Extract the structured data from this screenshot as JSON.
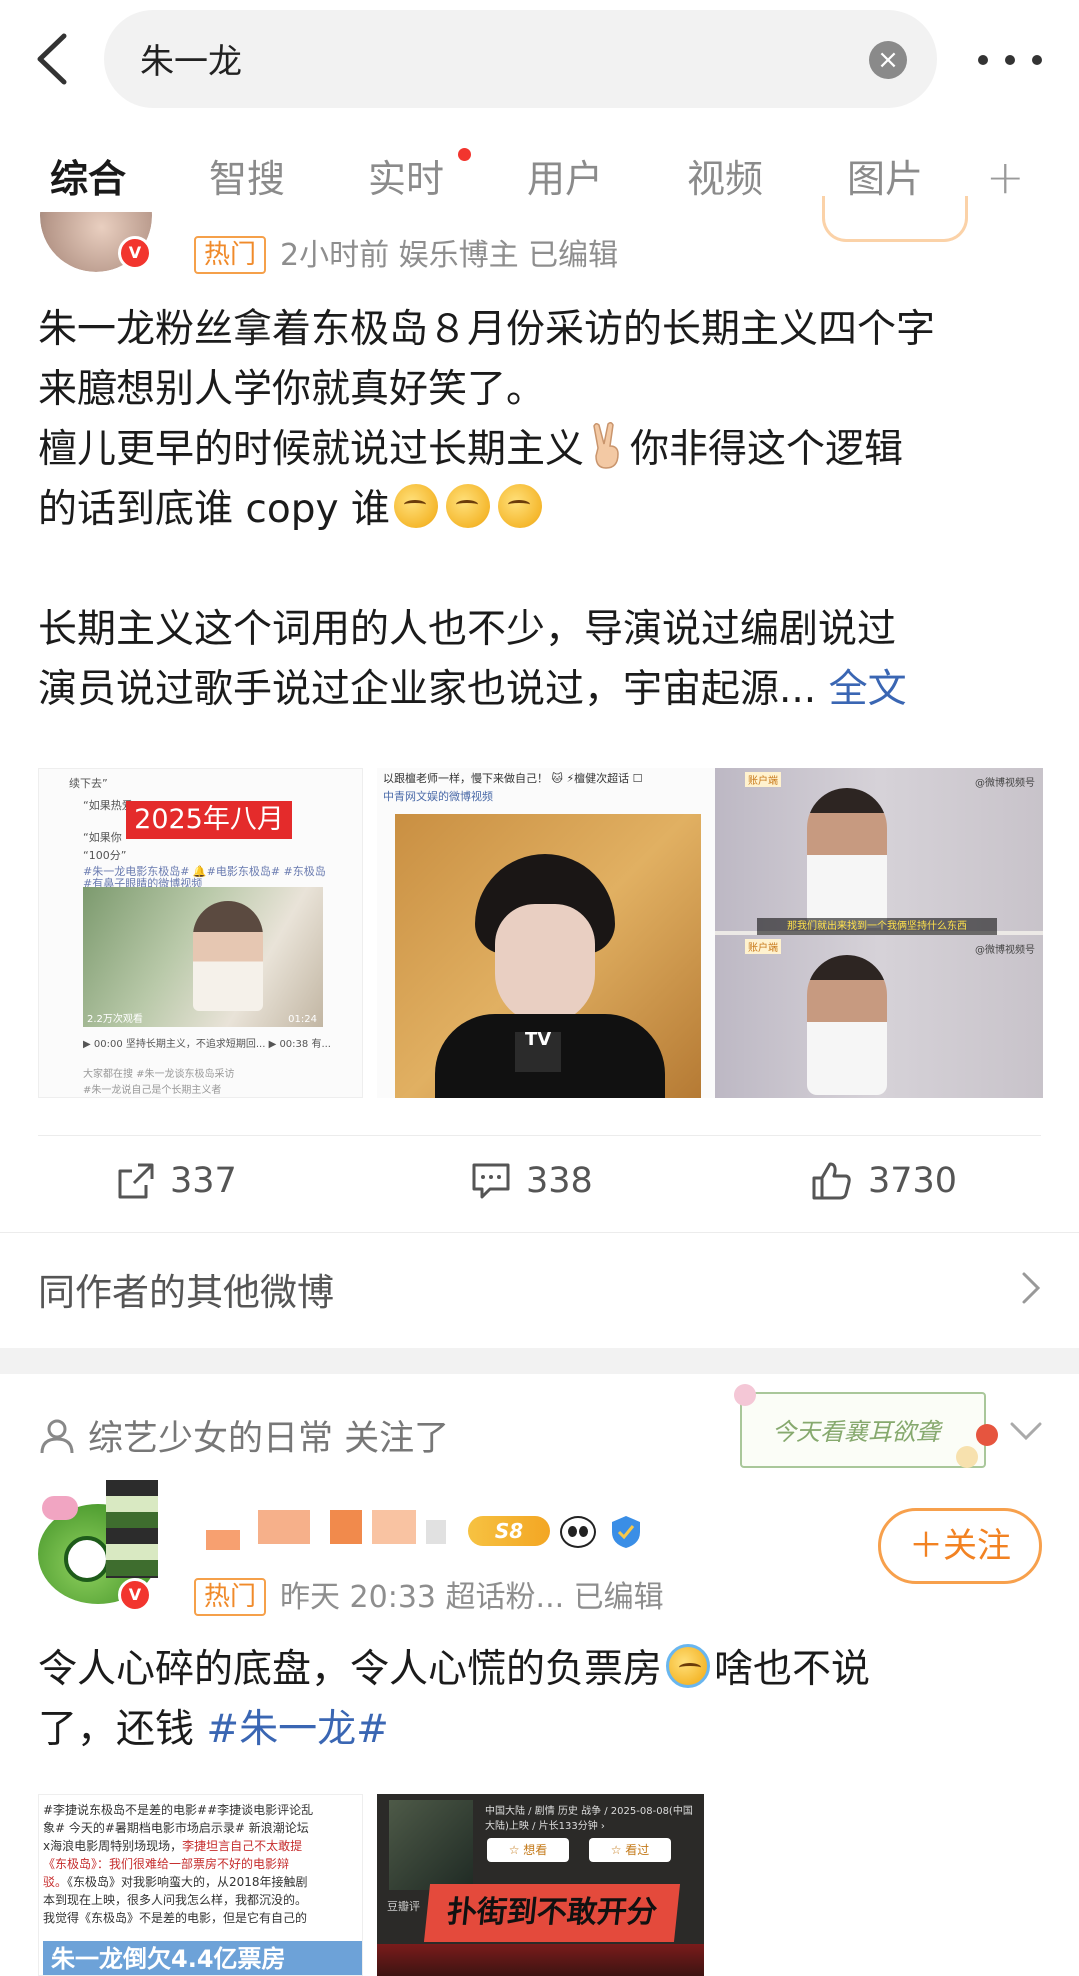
{
  "search": {
    "query": "朱一龙",
    "clear_icon": "clear-icon",
    "more_icon": "more-dots-icon"
  },
  "tabs": [
    {
      "label": "综合",
      "active": true
    },
    {
      "label": "智搜"
    },
    {
      "label": "实时",
      "badge_dot": true
    },
    {
      "label": "用户"
    },
    {
      "label": "视频"
    },
    {
      "label": "图片"
    },
    {
      "label": "+"
    }
  ],
  "colors": {
    "accent": "#ff8200",
    "link": "#3a66b3",
    "hot": "#f08a2a",
    "verified": "#f2352e"
  },
  "post1": {
    "hot_tag": "热门",
    "meta": "2小时前  娱乐博主  已编辑",
    "verified_icon": "verified-badge-icon",
    "lines": [
      "朱一龙粉丝拿着东极岛８月份采访的长期主义四个字",
      "来臆想别人学你就真好笑了。",
      "檀儿更早的时候就说过长期主义",
      "你非得这个逻辑",
      "的话到底谁 copy 谁",
      "长期主义这个词用的人也不少，导演说过编剧说过",
      "演员说过歌手说过企业家也说过，宇宙起源..."
    ],
    "full_text_link": "全文",
    "images": {
      "img1": {
        "banner": "2025年八月",
        "lines": [
          "续下去”",
          "“如果热爱",
          "“如果你",
          "“100分”",
          "#朱一龙电影东极岛# 🔔#电影东极岛# #东极岛",
          "#有鼻子眼睛的微博视频"
        ],
        "views": "2.2万次观看",
        "duration": "01:24",
        "caption": "▶ 00:00 坚持长期主义，不追求短期回...   ▶ 00:38 有...",
        "footer1": "大家都在搜    #朱一龙谈东极岛采访",
        "footer2": "#朱一龙说自己是个长期主义者"
      },
      "img2": {
        "header": "以跟檀老师一样，慢下来做自己！ 🐱 ⚡檀健次超话 ☐",
        "sub": "中青网文娱的微博视频",
        "mic_label": "TV"
      },
      "img3": {
        "tag": "账户端",
        "watermark": "@微博视频号",
        "subtitle": "那我们就出来找到一个我俩坚持什么东西",
        "tag2": "账户端",
        "watermark2": "@微博视频号"
      }
    },
    "actions": {
      "repost": "337",
      "comment": "338",
      "like": "3730"
    }
  },
  "other_posts_label": "同作者的其他微博",
  "post2": {
    "followed_by": "综艺少女的日常 关注了",
    "deco_text": "今天看襄耳欲聋",
    "level_badge": "S8",
    "follow_button": "＋关注",
    "hot_tag": "热门",
    "meta": "昨天 20:33  超话粉...  已编辑",
    "line1": "令人心碎的底盘，令人心慌的负票房",
    "line1_tail": "啥也不说",
    "line2": "了，还钱 ",
    "hashtag": "#朱一龙#",
    "image1": {
      "l1": "#李捷说东极岛不是差的电影##李捷谈电影评论乱",
      "l2": "象# 今天的#暑期档电影市场启示录# 新浪潮论坛",
      "l3": "x海浪电影周特别场现场，",
      "l3b": "李捷坦言自己不太敢提",
      "l4": "《东极岛》：我们很难给一部票房不好的电影辩",
      "l5a": "驳。",
      "l5b": "《东极岛》对我影响蛮大的，从2018年接触剧",
      "l6": "本到现在上映，很多人问我怎么样，我都沉没的。",
      "l7": "我觉得《东极岛》不是差的电影，但是它有自己的",
      "banner": "朱一龙倒欠4.4亿票房"
    },
    "image2": {
      "info": "中国大陆 / 剧情 历史 战争 / 2025-08-08(中国大陆)上映 / 片长133分钟 ›",
      "btn_want": "☆ 想看",
      "btn_seen": "☆ 看过",
      "side": "豆瓣评",
      "banner": "扑街到不敢开分"
    }
  }
}
